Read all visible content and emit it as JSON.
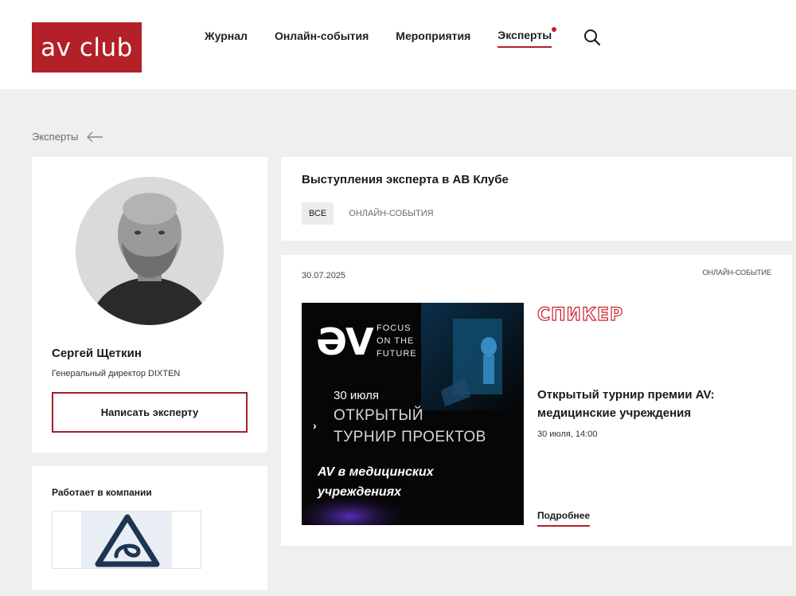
{
  "header": {
    "logo_text": "av club",
    "nav": [
      {
        "label": "Журнал"
      },
      {
        "label": "Онлайн-события"
      },
      {
        "label": "Мероприятия"
      },
      {
        "label": "Эксперты",
        "active": true
      }
    ],
    "search_icon": "search-icon"
  },
  "breadcrumb": {
    "label": "Эксперты",
    "icon": "arrow-left-icon"
  },
  "profile": {
    "name": "Сергей Щеткин",
    "position": "Генеральный директор DIXTEN",
    "write_button": "Написать эксперту"
  },
  "company": {
    "title": "Работает в компании"
  },
  "talks": {
    "title": "Выступления эксперта в АВ Клубе",
    "filters": [
      {
        "label": "ВСЕ",
        "active": true
      },
      {
        "label": "ОНЛАЙН-СОБЫТИЯ",
        "active": false
      }
    ]
  },
  "event": {
    "date": "30.07.2025",
    "type": "ОНЛАЙН-СОБЫТИЕ",
    "banner": {
      "logo": "ƏV",
      "tagline": [
        "FOCUS",
        "ON THE",
        "FUTURE"
      ],
      "date": "30 июля",
      "line1": "ОТКРЫТЫЙ",
      "line2": "ТУРНИР ПРОЕКТОВ",
      "bold1": "AV в медицинских",
      "bold2": "учреждениях"
    },
    "speaker_label": "СПИКЕР",
    "title": "Открытый турнир премии AV: медицинские учреждения",
    "time": "30 июля, 14:00",
    "more": "Подробнее"
  },
  "colors": {
    "accent": "#b42028",
    "background": "#efefef",
    "card": "#ffffff"
  }
}
